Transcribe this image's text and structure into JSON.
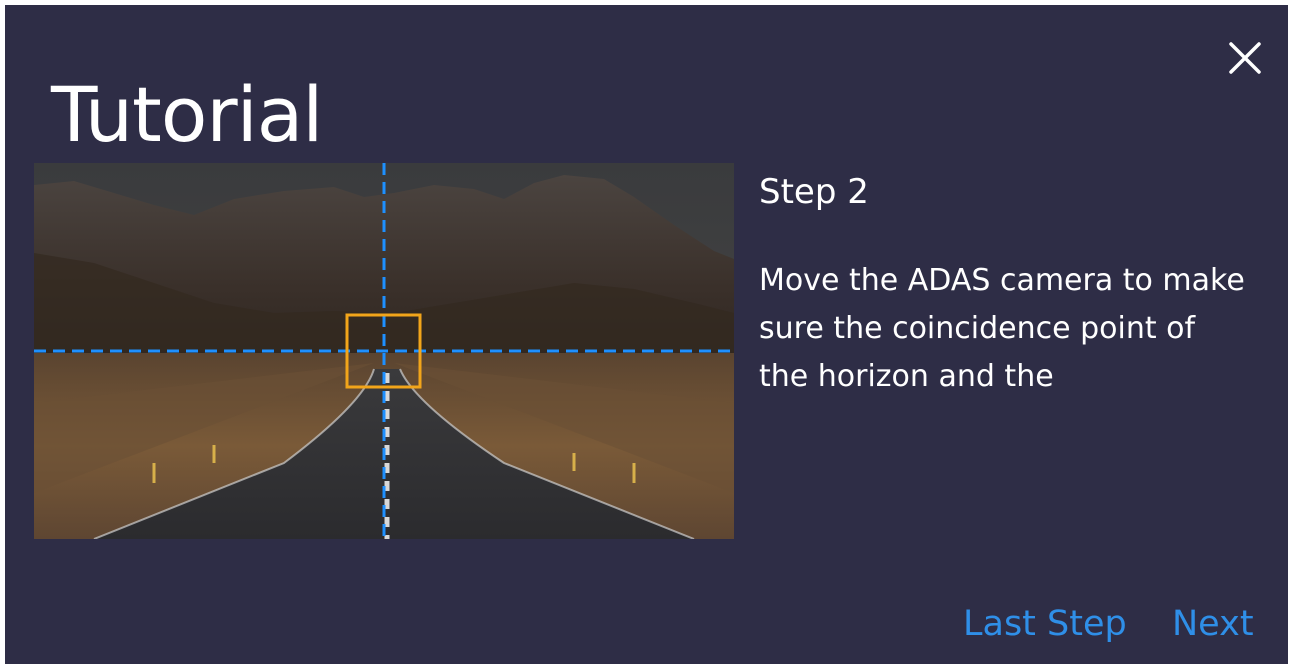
{
  "dialog": {
    "title": "Tutorial",
    "close_icon": "close-icon"
  },
  "step": {
    "title": "Step 2",
    "description": "Move the ADAS camera to make sure the coincidence point of the horizon and the"
  },
  "illustration": {
    "guide_line_color": "#1e90ff",
    "target_box_color": "#f2a51a"
  },
  "navigation": {
    "last_step_label": "Last Step",
    "next_label": "Next",
    "accent_color": "#2f8fe8"
  },
  "colors": {
    "dialog_background": "#2e2d46",
    "text": "#ffffff"
  }
}
